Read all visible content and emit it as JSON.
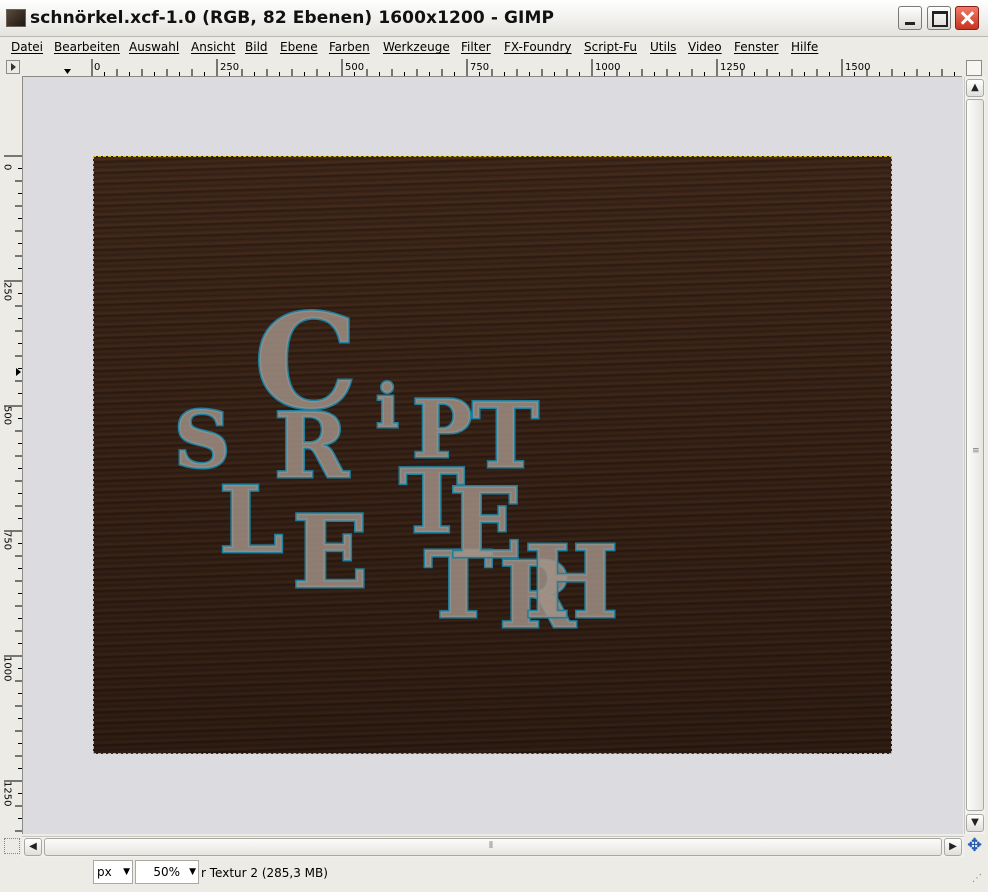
{
  "window": {
    "title": "schnörkel.xcf-1.0 (RGB, 82 Ebenen) 1600x1200 - GIMP",
    "icon": "gimp-image-icon"
  },
  "menu": [
    "Datei",
    "Bearbeiten",
    "Auswahl",
    "Ansicht",
    "Bild",
    "Ebene",
    "Farben",
    "Werkzeuge",
    "Filter",
    "FX-Foundry",
    "Script-Fu",
    "Utils",
    "Video",
    "Fenster",
    "Hilfe"
  ],
  "rulers": {
    "horizontal_labels": [
      "0",
      "250",
      "500",
      "750",
      "1000",
      "1250",
      "1500"
    ],
    "vertical_labels": [
      "0",
      "250",
      "500",
      "750",
      "1000",
      "1250"
    ]
  },
  "canvas": {
    "letters": [
      "S",
      "C",
      "R",
      "i",
      "P",
      "T",
      "L",
      "E",
      "T",
      "T",
      "E",
      "R",
      "H"
    ],
    "colors": {
      "fill": "#a39288",
      "stroke": "#1f7f9c",
      "wood": "#3b2518",
      "selection": "#d9c200"
    }
  },
  "statusbar": {
    "unit": "px",
    "zoom": "50%",
    "text": "r Textur 2 (285,3 MB)"
  },
  "colors": {
    "titlebar": "#ffffff",
    "chrome": "#ecebe6",
    "viewport": "#dcdce0",
    "close_button": "#c8321f"
  }
}
